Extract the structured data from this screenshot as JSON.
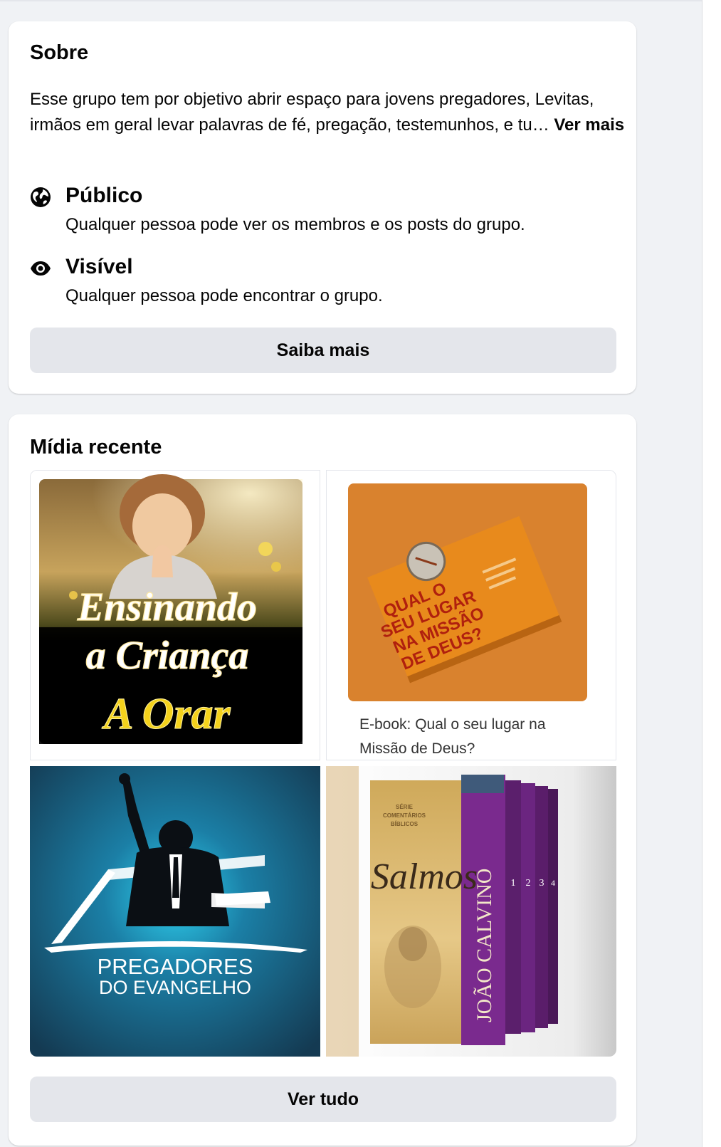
{
  "about": {
    "title": "Sobre",
    "description": "Esse grupo tem por objetivo abrir espaço para jovens pregadores, Levitas, irmãos em geral levar palavras de fé, pregação, testemunhos, e tu…",
    "see_more_label": "Ver mais",
    "privacy": {
      "title": "Público",
      "description": "Qualquer pessoa pode ver os membros e os posts do grupo.",
      "icon": "globe-icon"
    },
    "visibility": {
      "title": "Visível",
      "description": "Qualquer pessoa pode encontrar o grupo.",
      "icon": "eye-icon"
    },
    "learn_more_label": "Saiba mais"
  },
  "media": {
    "title": "Mídia recente",
    "items": [
      {
        "kind": "image",
        "lines": [
          "Ensinando",
          "a Criança",
          "A Orar"
        ]
      },
      {
        "kind": "link-preview",
        "book_title_lines": [
          "QUAL O",
          "SEU LUGAR",
          "NA MISSÃO",
          "DE DEUS?"
        ],
        "caption": "E-book: Qual o seu lugar na Missão de Deus?"
      },
      {
        "kind": "image",
        "lines": [
          "PREGADORES",
          "DO EVANGELHO"
        ]
      },
      {
        "kind": "image",
        "series_label_lines": [
          "SÉRIE",
          "COMENTÁRIOS",
          "BÍBLICOS"
        ],
        "title": "Salmos",
        "author": "JOÃO CALVINO",
        "volume_numbers": [
          "1",
          "2",
          "3",
          "4"
        ]
      }
    ],
    "see_all_label": "Ver tudo"
  },
  "colors": {
    "page_bg": "#f0f2f5",
    "card_bg": "#ffffff",
    "button_bg": "#e4e6eb",
    "text": "#050505"
  }
}
